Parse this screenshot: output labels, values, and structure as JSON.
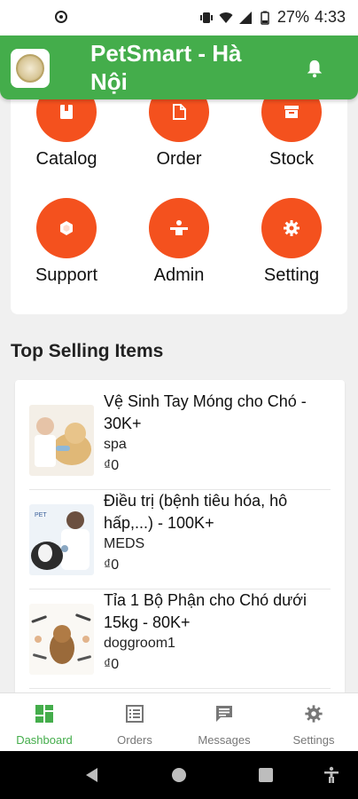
{
  "status_bar": {
    "battery": "27%",
    "time": "4:33"
  },
  "app_bar": {
    "title": "PetSmart - Hà Nội"
  },
  "menu": [
    {
      "label": "Catalog",
      "icon": "catalog-icon"
    },
    {
      "label": "Order",
      "icon": "order-icon"
    },
    {
      "label": "Stock",
      "icon": "stock-icon"
    },
    {
      "label": "Support",
      "icon": "support-icon"
    },
    {
      "label": "Admin",
      "icon": "admin-icon"
    },
    {
      "label": "Setting",
      "icon": "setting-icon"
    }
  ],
  "top_selling": {
    "title": "Top Selling Items",
    "items": [
      {
        "name": "Vệ Sinh Tay Móng cho Chó - 30K+",
        "category": "spa",
        "price": "₫0"
      },
      {
        "name": "Điều trị (bệnh tiêu hóa, hô hấp,...) - 100K+",
        "category": "MEDS",
        "price": "₫0"
      },
      {
        "name": "Tỉa 1 Bộ Phận cho Chó dưới 15kg - 80K+",
        "category": "doggroom1",
        "price": "₫0"
      }
    ]
  },
  "bottom_nav": [
    {
      "label": "Dashboard",
      "active": true
    },
    {
      "label": "Orders",
      "active": false
    },
    {
      "label": "Messages",
      "active": false
    },
    {
      "label": "Settings",
      "active": false
    }
  ],
  "colors": {
    "primary": "#44ad4b",
    "accent": "#f4511e",
    "background": "#f0f0f0"
  }
}
